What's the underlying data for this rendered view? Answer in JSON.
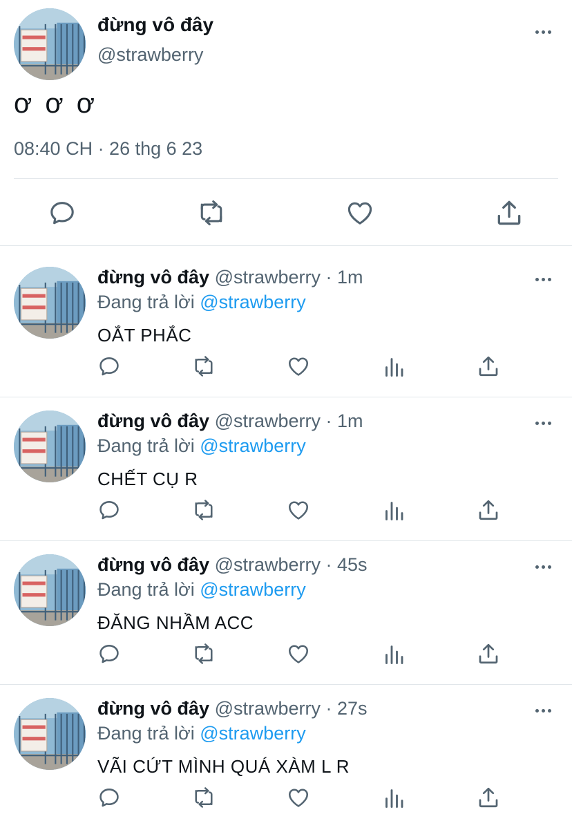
{
  "main_tweet": {
    "display_name": "đừng vô đây",
    "handle": "@strawberry",
    "text": "ơ ơ ơ",
    "timestamp": "08:40 CH · 26 thg 6 23",
    "avatar_sign_text": [
      "KHÔNG TIẾP",
      "NGƯỜI XÀM L"
    ],
    "more_icon": "more-horizontal-icon",
    "actions": [
      "reply-icon",
      "retweet-icon",
      "like-icon",
      "share-icon"
    ]
  },
  "replies": [
    {
      "display_name": "đừng vô đây",
      "meta": " @strawberry · 1m",
      "replying_prefix": "Đang trả lời ",
      "replying_to": "@strawberry",
      "text": "OẮT PHẮC"
    },
    {
      "display_name": "đừng vô đây",
      "meta": " @strawberry · 1m",
      "replying_prefix": "Đang trả lời ",
      "replying_to": "@strawberry",
      "text": "CHẾT CỤ R"
    },
    {
      "display_name": "đừng vô đây",
      "meta": " @strawberry · 45s",
      "replying_prefix": "Đang trả lời ",
      "replying_to": "@strawberry",
      "text": "ĐĂNG NHẦM ACC"
    },
    {
      "display_name": "đừng vô đây",
      "meta": " @strawberry · 27s",
      "replying_prefix": "Đang trả lời ",
      "replying_to": "@strawberry",
      "text": "VÃI CỨT MÌNH QUÁ XÀM L R"
    }
  ],
  "reply_actions": [
    "reply-icon",
    "retweet-icon",
    "like-icon",
    "analytics-icon",
    "share-icon"
  ],
  "colors": {
    "text_primary": "#0f1419",
    "text_secondary": "#536471",
    "link": "#1d9bf0",
    "divider": "#e1e6ea"
  }
}
